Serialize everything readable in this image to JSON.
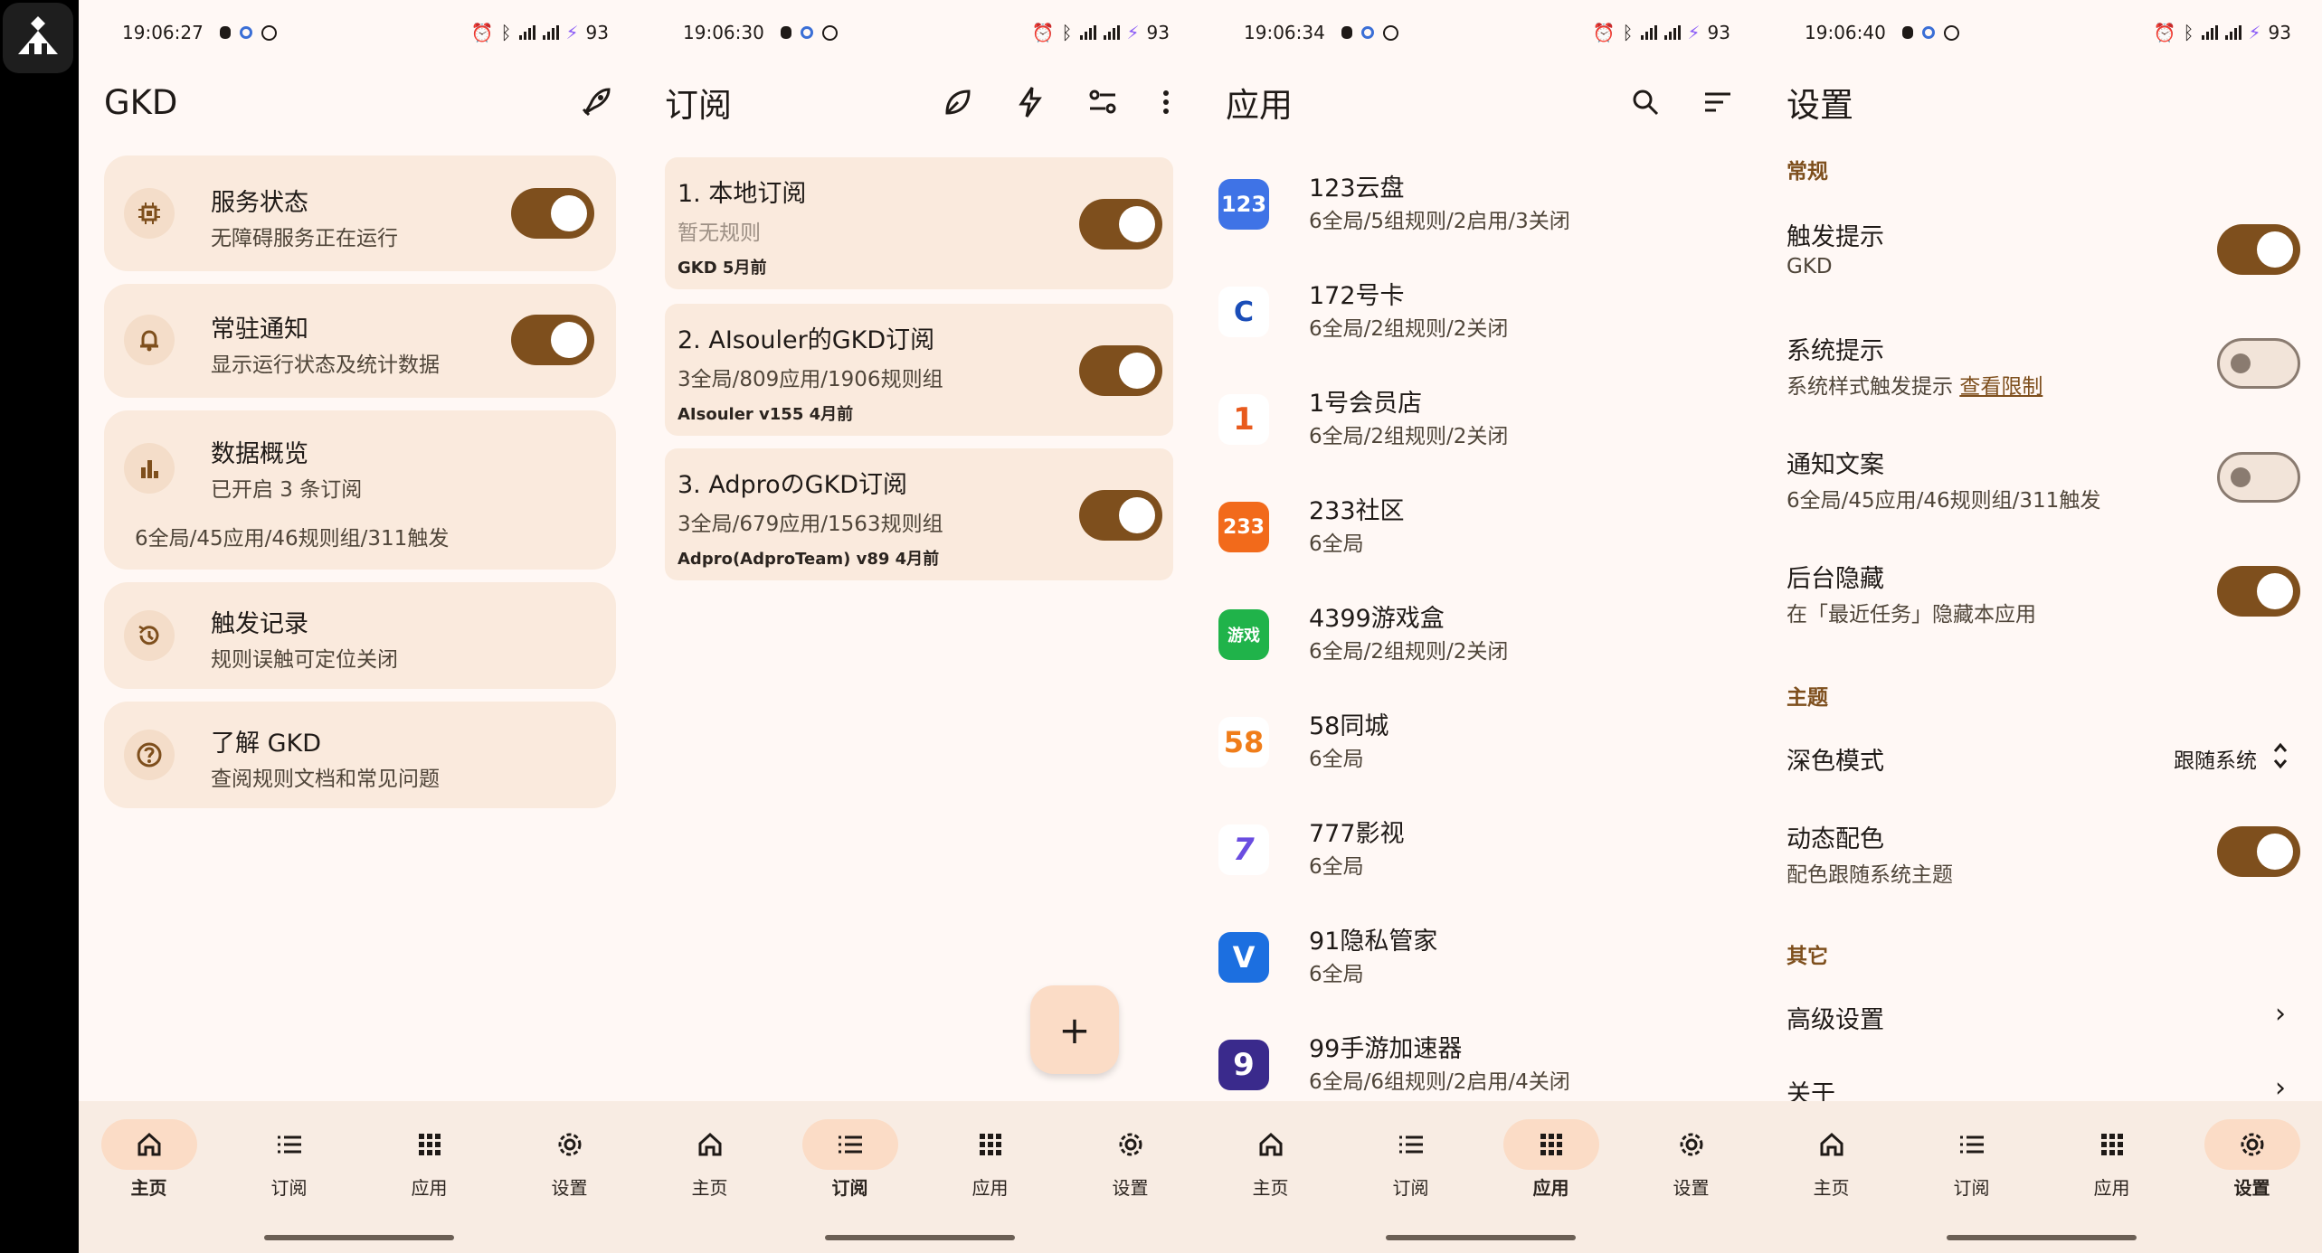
{
  "status": {
    "times": [
      "19:06:27",
      "19:06:30",
      "19:06:34",
      "19:06:40"
    ],
    "battery": "93"
  },
  "home": {
    "title": "GKD",
    "cards": [
      {
        "title": "服务状态",
        "sub": "无障碍服务正在运行",
        "toggle": true,
        "icon": "chip-icon"
      },
      {
        "title": "常驻通知",
        "sub": "显示运行状态及统计数据",
        "toggle": true,
        "icon": "bell-icon"
      },
      {
        "title": "数据概览",
        "sub": "已开启 3 条订阅",
        "extra": "6全局/45应用/46规则组/311触发",
        "icon": "bar-chart-icon"
      },
      {
        "title": "触发记录",
        "sub": "规则误触可定位关闭",
        "icon": "history-icon"
      },
      {
        "title": "了解 GKD",
        "sub": "查阅规则文档和常见问题",
        "icon": "help-icon"
      }
    ]
  },
  "subs": {
    "title": "订阅",
    "items": [
      {
        "title": "1. 本地订阅",
        "desc": "暂无规则",
        "meta": "GKD   5月前",
        "enabled": true
      },
      {
        "title": "2. AIsouler的GKD订阅",
        "desc": "3全局/809应用/1906规则组",
        "meta": "AIsouler   v155   4月前",
        "enabled": true
      },
      {
        "title": "3. AdproのGKD订阅",
        "desc": "3全局/679应用/1563规则组",
        "meta": "Adpro(AdproTeam)   v89   4月前",
        "enabled": true
      }
    ],
    "fab": "+"
  },
  "apps": {
    "title": "应用",
    "items": [
      {
        "name": "123云盘",
        "desc": "6全局/5组规则/2启用/3关闭",
        "icon_text": "123",
        "color": "#3f73e6"
      },
      {
        "name": "172号卡",
        "desc": "6全局/2组规则/2关闭",
        "icon_text": "C",
        "color": "#1a4db8"
      },
      {
        "name": "1号会员店",
        "desc": "6全局/2组规则/2关闭",
        "icon_text": "1",
        "color": "#e85a1d"
      },
      {
        "name": "233社区",
        "desc": "6全局",
        "icon_text": "233",
        "color": "#f26a1b"
      },
      {
        "name": "4399游戏盒",
        "desc": "6全局/2组规则/2关闭",
        "icon_text": "游戏",
        "color": "#20b34a"
      },
      {
        "name": "58同城",
        "desc": "6全局",
        "icon_text": "58",
        "color": "#ffffff"
      },
      {
        "name": "777影视",
        "desc": "6全局",
        "icon_text": "7",
        "color": "#ffffff"
      },
      {
        "name": "91隐私管家",
        "desc": "6全局",
        "icon_text": "V",
        "color": "#1c6fe0"
      },
      {
        "name": "99手游加速器",
        "desc": "6全局/6组规则/2启用/4关闭",
        "icon_text": "9",
        "color": "#3a2a8c"
      }
    ]
  },
  "settings": {
    "title": "设置",
    "section_general": "常规",
    "items_general": [
      {
        "title": "触发提示",
        "desc": "GKD",
        "on": true
      },
      {
        "title": "系统提示",
        "desc": "系统样式触发提示",
        "link": "查看限制",
        "on": false
      },
      {
        "title": "通知文案",
        "desc": "6全局/45应用/46规则组/311触发",
        "on": false
      },
      {
        "title": "后台隐藏",
        "desc": "在「最近任务」隐藏本应用",
        "on": true
      }
    ],
    "section_theme": "主题",
    "dark_mode": {
      "title": "深色模式",
      "value": "跟随系统"
    },
    "dynamic_color": {
      "title": "动态配色",
      "desc": "配色跟随系统主题",
      "on": true
    },
    "section_other": "其它",
    "advanced": "高级设置",
    "about": "关于"
  },
  "nav": {
    "home": "主页",
    "subs": "订阅",
    "apps": "应用",
    "settings": "设置"
  },
  "colors": {
    "accent": "#7e4f1d",
    "card": "#faeadd",
    "background": "#fff8f5"
  }
}
